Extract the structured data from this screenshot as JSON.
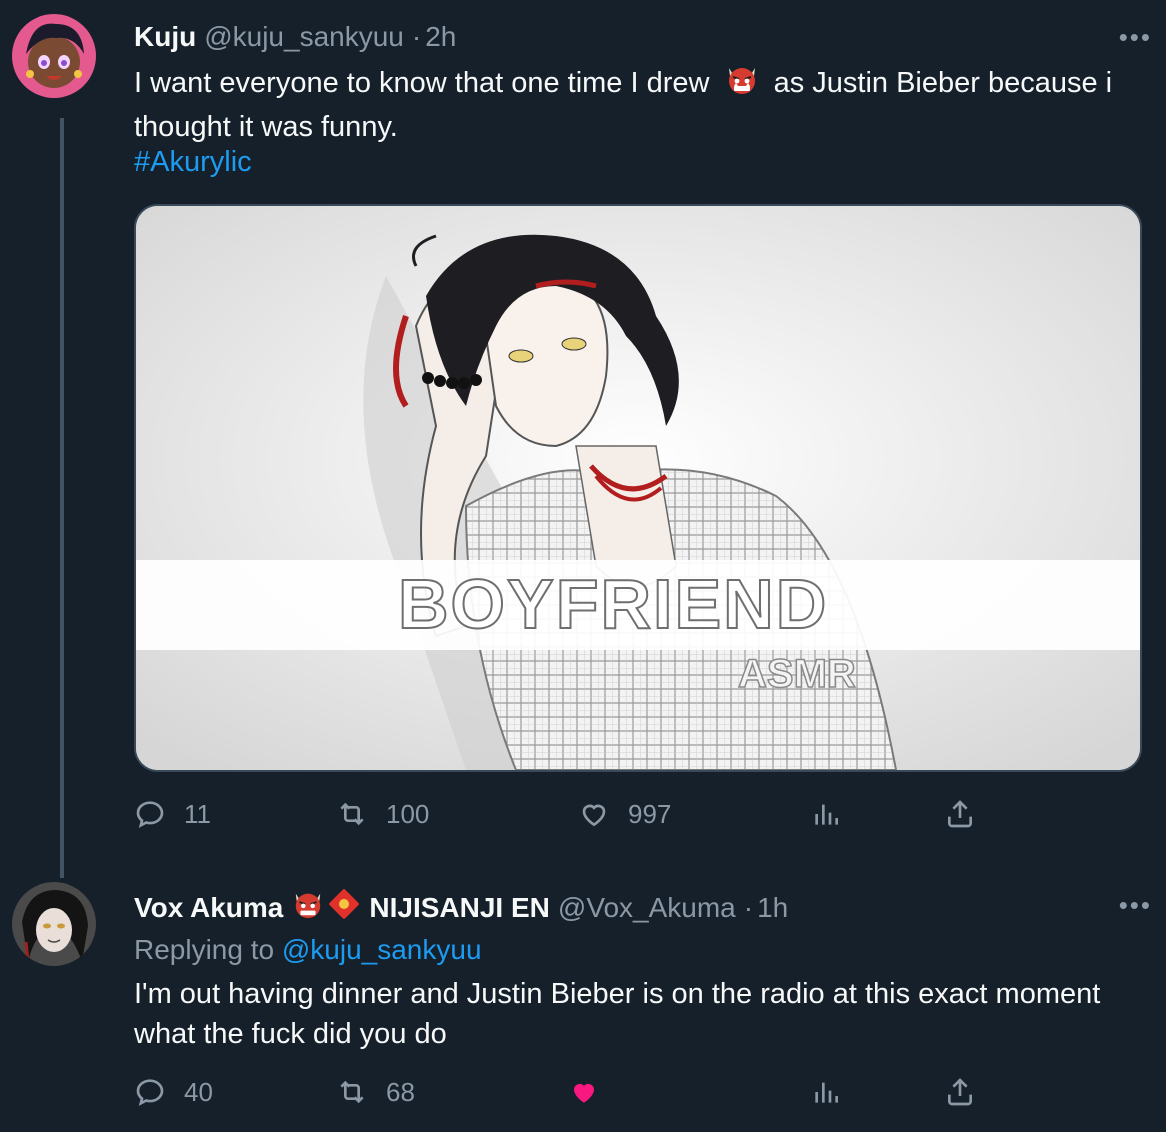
{
  "tweets": [
    {
      "author_name": "Kuju",
      "handle": "@kuju_sankyuu",
      "separator": "·",
      "time": "2h",
      "more": "•••",
      "text_part1": "I want everyone to know that one time I drew",
      "text_emoji": "ogre-emoji",
      "text_part2": "as Justin Bieber because i thought it was funny.",
      "hashtag": "#Akurylic",
      "media": {
        "title": "BOYFRIEND",
        "subtitle": "ASMR"
      },
      "stats": {
        "replies": "11",
        "retweets": "100",
        "likes": "997"
      },
      "liked": false
    },
    {
      "author_name": "Vox Akuma",
      "author_emojis": [
        "ogre-emoji",
        "red-envelope-emoji"
      ],
      "author_suffix": "NIJISANJI EN",
      "handle": "@Vox_Akuma",
      "separator": "·",
      "time": "1h",
      "more": "•••",
      "replying_to_label": "Replying to",
      "replying_to_handle": "@kuju_sankyuu",
      "text": "I'm out having dinner and Justin Bieber is on the radio at this exact moment what the fuck did you do",
      "stats": {
        "replies": "40",
        "retweets": "68",
        "likes": ""
      },
      "liked": true
    }
  ],
  "colors": {
    "background": "#15202b",
    "text": "#f7f9f9",
    "muted": "#8b98a5",
    "link": "#1d9bf0",
    "like_active": "#f91880",
    "thread_line": "#425364"
  }
}
